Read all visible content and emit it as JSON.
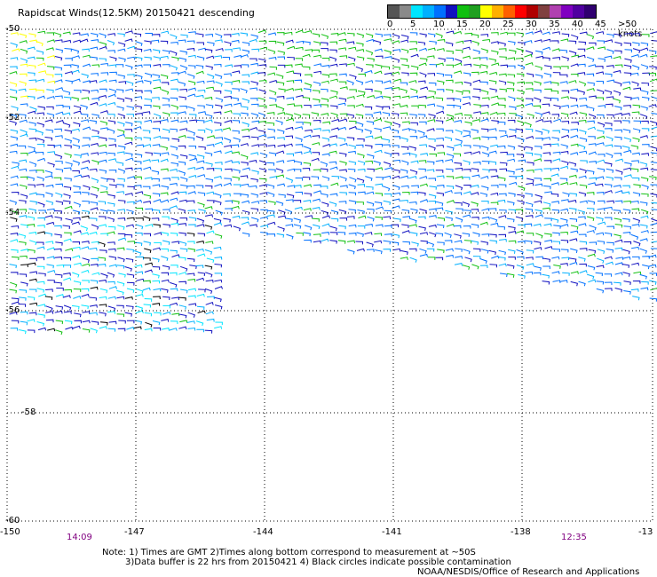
{
  "title": "Rapidscat Winds(12.5KM) 20150421 descending",
  "legend": {
    "colors": [
      "#555555",
      "#8a8a8a",
      "#00e5ff",
      "#00b0ff",
      "#0070ff",
      "#1010c0",
      "#10c010",
      "#20a020",
      "#ffff00",
      "#ffb000",
      "#ff6000",
      "#ff0000",
      "#b00000",
      "#804040",
      "#b040b0",
      "#8000c0",
      "#5000a0",
      "#300070"
    ],
    "labels": [
      "0",
      "5",
      "10",
      "15",
      "20",
      "25",
      "30",
      "35",
      "40",
      "45",
      ">50 knots"
    ]
  },
  "lat_labels": [
    "-50",
    "-52",
    "-54",
    "-56",
    "-58",
    "-60"
  ],
  "lon_labels": [
    "-150",
    "-147",
    "-144",
    "-141",
    "-138",
    "-13"
  ],
  "times": [
    "14:09",
    "12:35"
  ],
  "notes": [
    "Note: 1) Times are GMT 2)Times along bottom correspond to measurement at ~50S",
    "3)Data buffer is 22 hrs from 20150421 4) Black circles indicate possible contamination",
    "NOAA/NESDIS/Office of Research and Applications"
  ]
}
